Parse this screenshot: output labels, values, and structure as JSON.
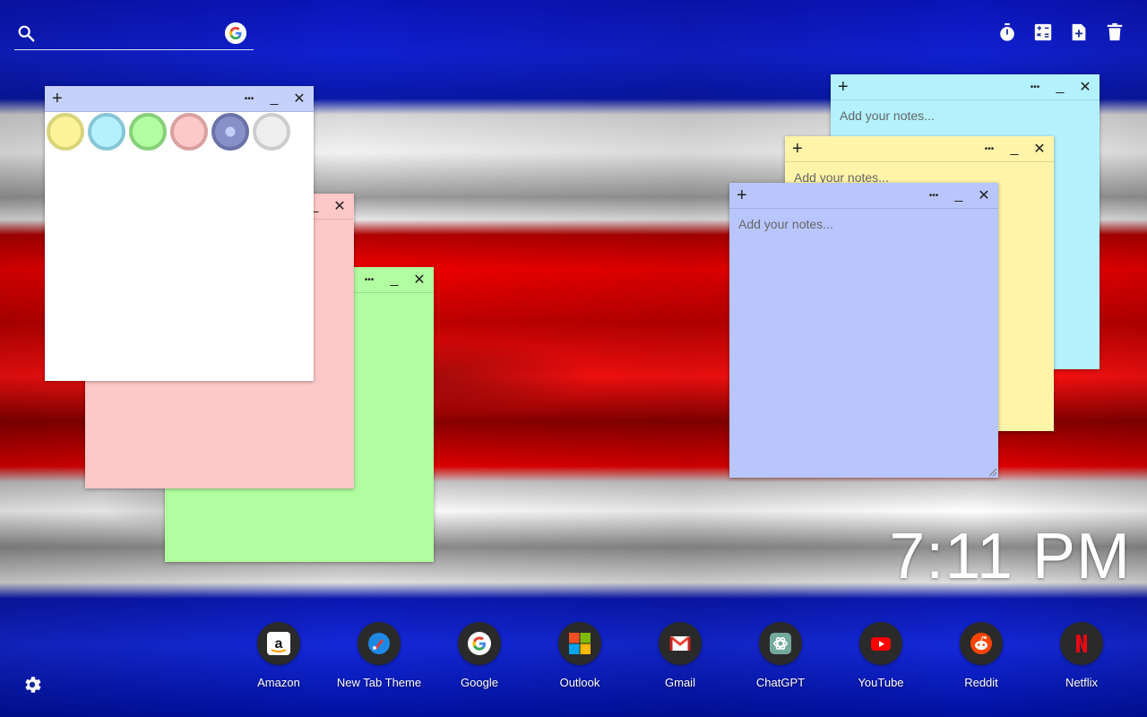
{
  "search": {
    "placeholder": ""
  },
  "notes": {
    "placeholder": "Add your notes...",
    "menu_glyph": "•••",
    "minimize_glyph": "_",
    "close_glyph": "✕",
    "add_glyph": "+"
  },
  "colors": {
    "white_note": "#ffffff",
    "white_bar": "#c5d0fb",
    "pink": "#ffc8c8",
    "green": "#b2fda0",
    "cyan": "#b3f2fd",
    "yellow": "#fff4a8",
    "blue": "#b9c6fd"
  },
  "palette": [
    {
      "name": "yellow",
      "fill": "#fff39a",
      "ring": "#d8d47a"
    },
    {
      "name": "cyan",
      "fill": "#b3f2fd",
      "ring": "#86c6d6"
    },
    {
      "name": "green",
      "fill": "#b2fda0",
      "ring": "#86d07a"
    },
    {
      "name": "pink",
      "fill": "#ffc8c8",
      "ring": "#d8a0a0"
    },
    {
      "name": "blue",
      "fill": "#8890c8",
      "ring": "#6a72a8",
      "selected": true
    },
    {
      "name": "white",
      "fill": "#eeeeee",
      "ring": "#cccccc"
    }
  ],
  "clock": {
    "time": "7:11 PM"
  },
  "toolbar": {
    "icons": [
      "timer-icon",
      "calculator-icon",
      "add-note-icon",
      "trash-icon"
    ]
  },
  "shortcuts": [
    {
      "label": "Amazon",
      "icon": "amazon-icon"
    },
    {
      "label": "New Tab Theme",
      "icon": "new-tab-theme-icon"
    },
    {
      "label": "Google",
      "icon": "google-icon"
    },
    {
      "label": "Outlook",
      "icon": "outlook-icon"
    },
    {
      "label": "Gmail",
      "icon": "gmail-icon"
    },
    {
      "label": "ChatGPT",
      "icon": "chatgpt-icon"
    },
    {
      "label": "YouTube",
      "icon": "youtube-icon"
    },
    {
      "label": "Reddit",
      "icon": "reddit-icon"
    },
    {
      "label": "Netflix",
      "icon": "netflix-icon"
    }
  ]
}
